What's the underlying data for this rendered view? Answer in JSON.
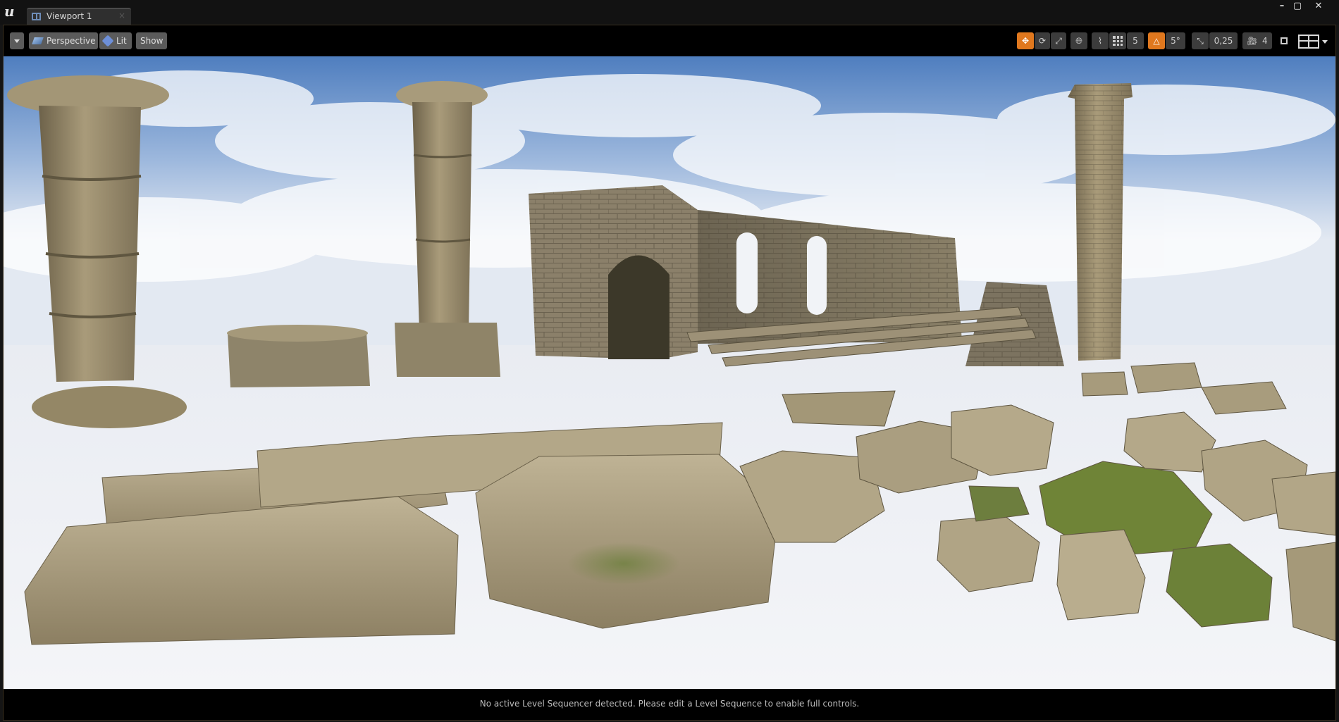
{
  "app": {
    "logo_letter": "u"
  },
  "tab": {
    "title": "Viewport 1",
    "close_glyph": "×"
  },
  "window_controls": {
    "minimize": "–",
    "maximize": "▢",
    "close": "✕"
  },
  "toolbar": {
    "perspective_label": "Perspective",
    "lit_label": "Lit",
    "show_label": "Show",
    "grid_snap_value": "5",
    "rotation_snap_value": "5°",
    "scale_snap_value": "0,25",
    "camera_speed_value": "4"
  },
  "status": {
    "message": "No active Level Sequencer detected. Please edit a Level Sequence to enable full controls."
  },
  "colors": {
    "accent_orange": "#e0781e",
    "toolbar_bg": "#000000",
    "sky_top": "#5d86c4",
    "ground": "#eef0f5",
    "stone": "#a89a78"
  }
}
